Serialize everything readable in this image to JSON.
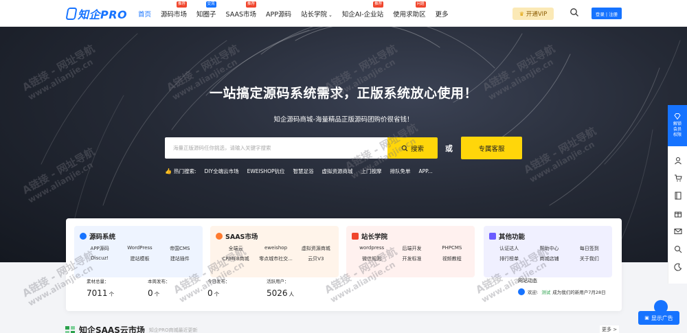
{
  "header": {
    "logo": "知企PRO",
    "nav": [
      {
        "label": "首页",
        "badge": "",
        "dropdown": false,
        "active": true
      },
      {
        "label": "源码市场",
        "badge": "推荐",
        "badge_color": "red",
        "dropdown": false,
        "active": false
      },
      {
        "label": "知圈子",
        "badge": "交流",
        "badge_color": "blue",
        "dropdown": false,
        "active": false
      },
      {
        "label": "SAAS市场",
        "badge": "推荐",
        "badge_color": "red",
        "dropdown": false,
        "active": false
      },
      {
        "label": "APP源码",
        "badge": "",
        "dropdown": false,
        "active": false
      },
      {
        "label": "站长学院",
        "badge": "",
        "dropdown": true,
        "active": false
      },
      {
        "label": "知企AI-企业站",
        "badge": "推荐",
        "badge_color": "red",
        "dropdown": false,
        "active": false
      },
      {
        "label": "使用求助区",
        "badge": "问题",
        "badge_color": "red",
        "dropdown": false,
        "active": false
      },
      {
        "label": "更多",
        "badge": "",
        "dropdown": false,
        "active": false
      }
    ],
    "vip_label": "开通VIP",
    "login_label": "登录 | 注册"
  },
  "hero": {
    "title": "一站搞定源码系统需求，正版系统放心使用！",
    "subtitle": "知企源码商城-海量精品正版源码团购价很省钱！",
    "search_placeholder": "海量正版源码任你挑选，请输入关键字搜索",
    "search_button": "搜索",
    "or_text": "或",
    "service_button": "专属客服",
    "hot_label": "热门搜索:",
    "hot_items": [
      "DIY全端云市场",
      "EWEISHOP钪位",
      "智慧足浴",
      "虚拟资源商城",
      "上门按摩",
      "排队免单",
      "APP..."
    ]
  },
  "categories": [
    {
      "title": "源码系统",
      "items": [
        "APP源码",
        "WordPress",
        "帝国CMS",
        "Discuz!",
        "建站模板",
        "建站插件"
      ]
    },
    {
      "title": "SAAS市场",
      "items": [
        "全端云",
        "eweishop",
        "虚拟资源商城",
        "CRMEB商城",
        "零点城市社交...",
        "云贝V3"
      ]
    },
    {
      "title": "站长学院",
      "items": [
        "wordpress",
        "后端开发",
        "PHPCMS",
        "微信规则",
        "开发标准",
        "视频教程"
      ]
    },
    {
      "title": "其他功能",
      "items": [
        "认证达人",
        "帮助中心",
        "每日签到",
        "排行榜单",
        "商城店铺",
        "关于我们"
      ]
    }
  ],
  "stats": [
    {
      "label": "素材总量：",
      "value": "7011",
      "unit": "个"
    },
    {
      "label": "本周发布：",
      "value": "0",
      "unit": "个"
    },
    {
      "label": "今日发布：",
      "value": "0",
      "unit": "个"
    },
    {
      "label": "活跃用户：",
      "value": "5026",
      "unit": "人"
    }
  ],
  "news": {
    "title": "网站动态",
    "welcome": "欢迎:",
    "user": "测试",
    "message": "成为我们的新用户7月28日"
  },
  "section": {
    "title": "知企SAAS云市场",
    "subtitle": "知企PRO商城最近更新",
    "more": "更多 >"
  },
  "sidebar": {
    "vip_tab": "解锁会员权限"
  },
  "show_ad": "显示广告",
  "watermark": {
    "text": "A链接 - 网址导航",
    "url": "www.alianjie.cn"
  },
  "colors": {
    "brand": "#1673ff",
    "accent": "#ffd60a",
    "badge_red": "#f0462d"
  }
}
